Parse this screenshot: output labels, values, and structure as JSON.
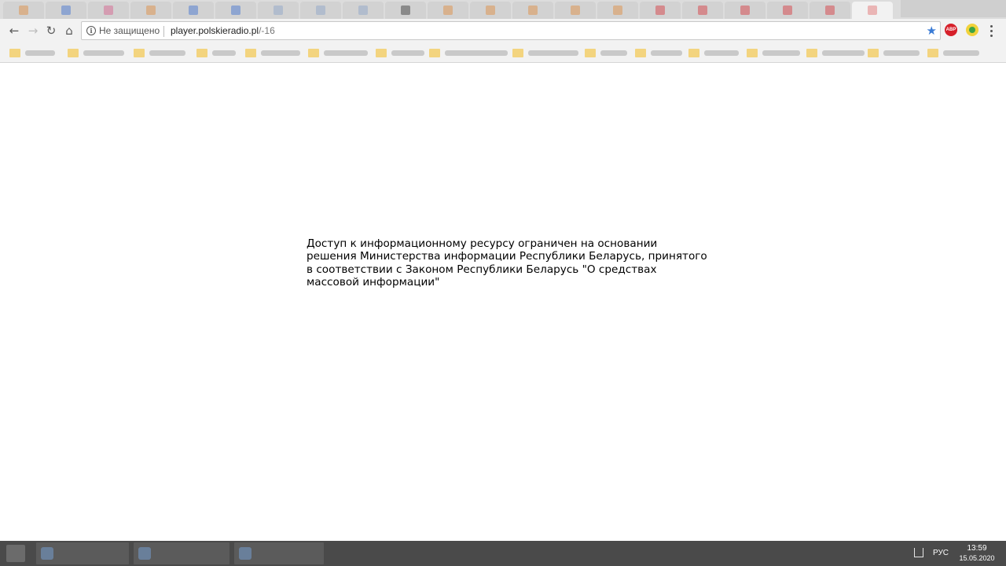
{
  "browser": {
    "address_bar": {
      "security_label": "Не защищено",
      "url_host": "player.polskieradio.pl",
      "url_path": "/-16"
    }
  },
  "page": {
    "message": "Доступ к информационному ресурсу ограничен на основании решения Министерства информации Республики Беларусь, принятого в соответствии с Законом Республики Беларусь \"О средствах массовой информации\""
  },
  "taskbar": {
    "language": "РУС",
    "time": "13:59",
    "date": "15.05.2020"
  },
  "colors": {
    "star": "#3a7bd5",
    "adblock": "#d6202a",
    "taskbar": "#4a4a4a"
  }
}
